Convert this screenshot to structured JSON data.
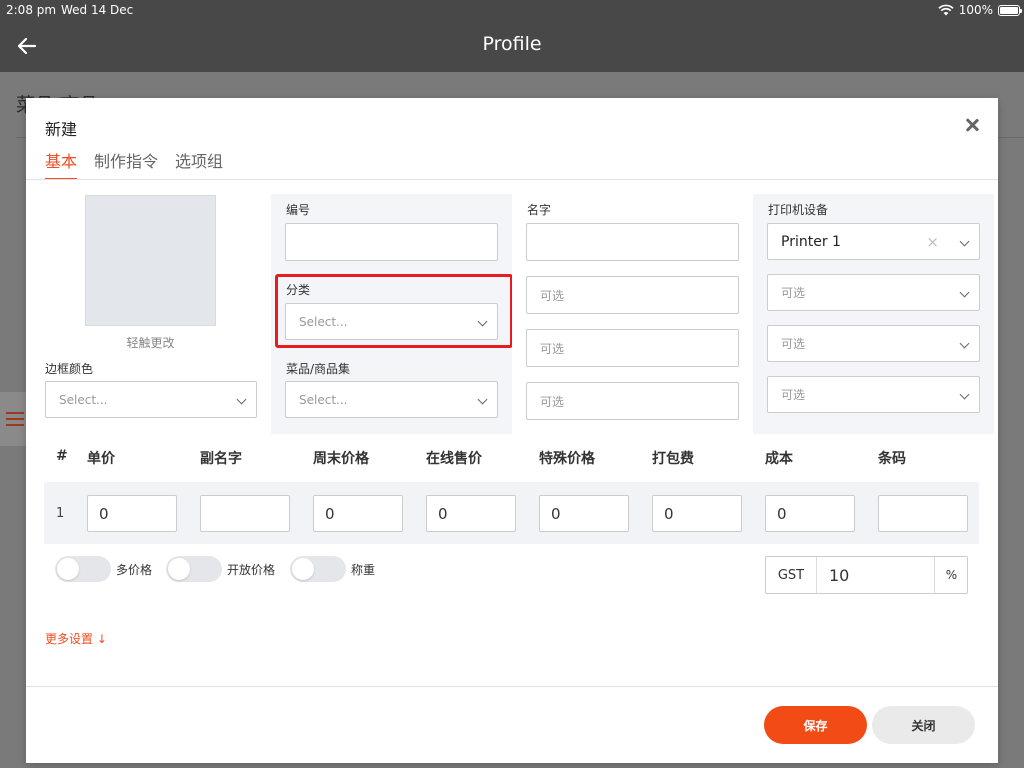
{
  "statusbar": {
    "time": "2:08 pm",
    "date": "Wed 14 Dec",
    "battery": "100%"
  },
  "header": {
    "title": "Profile"
  },
  "background": {
    "title": "菜品/商品"
  },
  "modal": {
    "title": "新建",
    "tabs": [
      {
        "label": "基本"
      },
      {
        "label": "制作指令"
      },
      {
        "label": "选项组"
      }
    ],
    "image": {
      "caption": "轻触更改"
    },
    "border_color": {
      "label": "边框颜色",
      "placeholder": "Select..."
    },
    "code": {
      "label": "编号",
      "value": ""
    },
    "category": {
      "label": "分类",
      "placeholder": "Select..."
    },
    "collection": {
      "label": "菜品/商品集",
      "placeholder": "Select..."
    },
    "name": {
      "label": "名字",
      "value": "",
      "optional_1": "可选",
      "optional_2": "可选",
      "optional_3": "可选"
    },
    "printer": {
      "label": "打印机设备",
      "selected": "Printer 1",
      "optional_1": "可选",
      "optional_2": "可选",
      "optional_3": "可选"
    },
    "price_table": {
      "headers": {
        "num": "#",
        "unit_price": "单价",
        "sub_name": "副名字",
        "weekend_price": "周末价格",
        "online_price": "在线售价",
        "special_price": "特殊价格",
        "packing_fee": "打包费",
        "cost": "成本",
        "barcode": "条码"
      },
      "row": {
        "num": "1",
        "unit_price": "0",
        "sub_name": "",
        "weekend_price": "0",
        "online_price": "0",
        "special_price": "0",
        "packing_fee": "0",
        "cost": "0",
        "barcode": ""
      }
    },
    "toggles": {
      "multi_price": "多价格",
      "open_price": "开放价格",
      "weigh": "称重"
    },
    "gst": {
      "label": "GST",
      "value": "10",
      "unit": "%"
    },
    "more_settings": "更多设置 ↓",
    "buttons": {
      "save": "保存",
      "close": "关闭"
    }
  },
  "colors": {
    "accent": "#f04e23",
    "header_bg": "#484848",
    "highlight": "#e81c1c"
  }
}
